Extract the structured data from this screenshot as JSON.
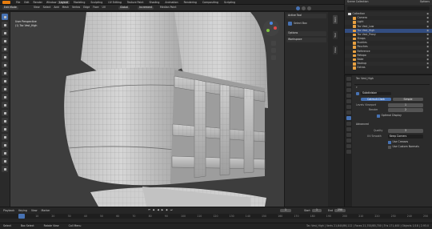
{
  "topbar": {
    "menus": [
      "File",
      "Edit",
      "Render",
      "Window",
      "Help"
    ],
    "workspaces": [
      "Layout",
      "Modeling",
      "Sculpting",
      "UV Editing",
      "Texture Paint",
      "Shading",
      "Animation",
      "Rendering",
      "Compositing",
      "Scripting"
    ],
    "active_workspace": "Layout",
    "scene": "Scene",
    "view_layer": "ViewLayer"
  },
  "viewport_header": {
    "mode": "Edit Mode",
    "menus": [
      "View",
      "Select",
      "Add",
      "Mesh",
      "Vertex",
      "Edge",
      "Face",
      "UV"
    ],
    "orientation": "Global",
    "snap": "Increment",
    "transform_pivot": "Median Point"
  },
  "viewport_overlay": {
    "view_name": "User Perspective",
    "object_info": "(1) Tac Vest_High"
  },
  "npanel": {
    "header": "Active Tool",
    "tool_name": "Select Box",
    "options_label": "Options",
    "workspace_label": "Workspace"
  },
  "side_tabs": [
    "Item",
    "Tool",
    "View"
  ],
  "outliner": {
    "title": "Scene Collection",
    "filter": "Options",
    "rows": [
      {
        "label": "Collection",
        "selected": false,
        "indent": 0
      },
      {
        "label": "Camera",
        "selected": false,
        "indent": 1
      },
      {
        "label": "Light",
        "selected": false,
        "indent": 1
      },
      {
        "label": "Tac Vest_Low",
        "selected": false,
        "indent": 1
      },
      {
        "label": "Tac Vest_High",
        "selected": true,
        "indent": 1
      },
      {
        "label": "Tac Vest_Proxy",
        "selected": false,
        "indent": 1
      },
      {
        "label": "Straps",
        "selected": false,
        "indent": 1
      },
      {
        "label": "Buckles",
        "selected": false,
        "indent": 1
      },
      {
        "label": "Pouches",
        "selected": false,
        "indent": 1
      },
      {
        "label": "Reference",
        "selected": false,
        "indent": 1
      },
      {
        "label": "Retopo",
        "selected": false,
        "indent": 1
      },
      {
        "label": "Bake",
        "selected": false,
        "indent": 1
      },
      {
        "label": "Backup",
        "selected": false,
        "indent": 1
      },
      {
        "label": "Extras",
        "selected": false,
        "indent": 1
      }
    ]
  },
  "properties": {
    "object_name": "Tac Vest_High",
    "modifier_name": "Subdivision",
    "mode_buttons": [
      "Catmull-Clark",
      "Simple"
    ],
    "fields": [
      {
        "label": "Levels Viewport",
        "value": "1"
      },
      {
        "label": "Render",
        "value": "2"
      }
    ],
    "optimal_display": "Optimal Display",
    "advanced_header": "Advanced",
    "quality": {
      "label": "Quality",
      "value": "3"
    },
    "uv_smooth": {
      "label": "UV Smooth",
      "value": "Keep Corners"
    },
    "checkboxes": [
      "Use Creases",
      "Use Custom Normals"
    ]
  },
  "timeline": {
    "menus": [
      "Playback",
      "Keying",
      "View",
      "Marker"
    ],
    "current_frame": "1",
    "start_label": "Start",
    "start": "1",
    "end_label": "End",
    "end": "250",
    "ticks": [
      "0",
      "10",
      "20",
      "30",
      "40",
      "50",
      "60",
      "70",
      "80",
      "90",
      "100",
      "110",
      "120",
      "130",
      "140",
      "150",
      "160",
      "170",
      "180",
      "190",
      "200",
      "210",
      "220",
      "230",
      "240",
      "250"
    ]
  },
  "statusbar": {
    "left": [
      "Select",
      "Box Select",
      "Rotate View",
      "Call Menu"
    ],
    "right": "Tac Vest_High | Verts 21,840/86,112 | Faces 21,700/85,700 | Tris 171,400 | Objects 1/18 | 2.93.0"
  }
}
